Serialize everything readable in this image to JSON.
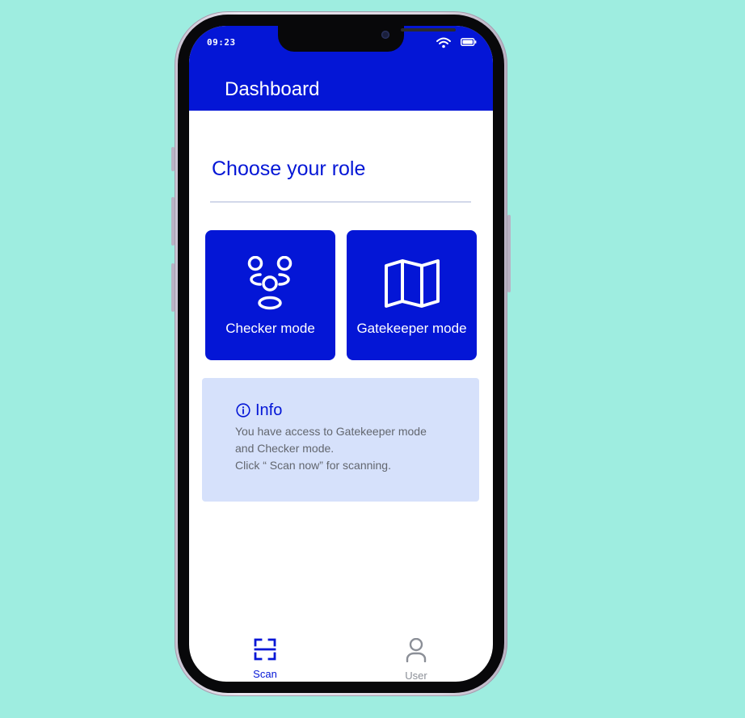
{
  "status_bar": {
    "time": "09:23"
  },
  "app_bar": {
    "title": "Dashboard"
  },
  "main": {
    "heading": "Choose your role",
    "roles": [
      {
        "label": "Checker mode",
        "icon": "people-group-icon"
      },
      {
        "label": "Gatekeeper mode",
        "icon": "map-icon"
      }
    ],
    "info": {
      "title": "Info",
      "icon": "info-circle-icon",
      "lines": [
        "You have access to Gatekeeper mode",
        "and Checker mode.",
        "Click “ Scan now” for scanning."
      ]
    }
  },
  "bottom_nav": {
    "items": [
      {
        "label": "Scan",
        "icon": "scan-icon",
        "active": true
      },
      {
        "label": "User",
        "icon": "user-icon",
        "active": false
      }
    ]
  },
  "colors": {
    "primary": "#0416d6",
    "info_background": "#d6e1fb",
    "inactive": "#8b8f97",
    "page_background": "#9eede0"
  }
}
